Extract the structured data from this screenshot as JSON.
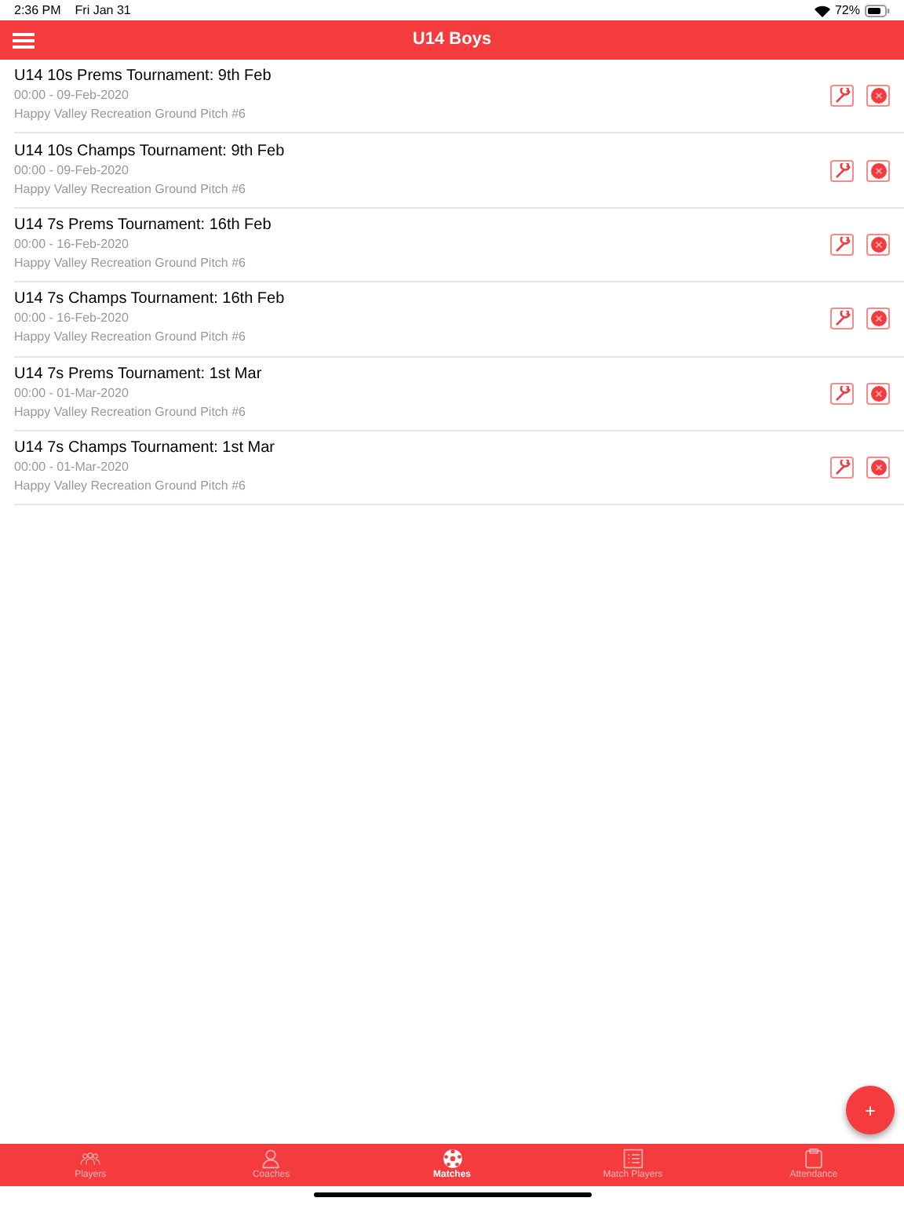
{
  "status_bar": {
    "time": "2:36 PM",
    "date": "Fri Jan 31",
    "battery": "72%"
  },
  "header": {
    "title": "U14 Boys"
  },
  "matches": [
    {
      "title": "U14 10s Prems Tournament: 9th Feb",
      "when": "00:00 - 09-Feb-2020",
      "venue": "Happy Valley Recreation Ground Pitch #6"
    },
    {
      "title": "U14 10s Champs Tournament: 9th Feb",
      "when": "00:00 - 09-Feb-2020",
      "venue": "Happy Valley Recreation Ground Pitch #6"
    },
    {
      "title": "U14 7s Prems Tournament: 16th Feb",
      "when": "00:00 - 16-Feb-2020",
      "venue": "Happy Valley Recreation Ground Pitch #6"
    },
    {
      "title": "U14 7s Champs Tournament: 16th Feb",
      "when": "00:00 - 16-Feb-2020",
      "venue": "Happy Valley Recreation Ground Pitch #6"
    },
    {
      "title": "U14 7s Prems Tournament: 1st Mar",
      "when": "00:00 - 01-Mar-2020",
      "venue": "Happy Valley Recreation Ground Pitch #6"
    },
    {
      "title": "U14 7s Champs Tournament: 1st Mar",
      "when": "00:00 - 01-Mar-2020",
      "venue": "Happy Valley Recreation Ground Pitch #6"
    }
  ],
  "add_button": {
    "label": "+"
  },
  "tabs": [
    {
      "label": "Players",
      "selected": false
    },
    {
      "label": "Coaches",
      "selected": false
    },
    {
      "label": "Matches",
      "selected": true
    },
    {
      "label": "Match Players",
      "selected": false
    },
    {
      "label": "Attendance",
      "selected": false
    }
  ]
}
